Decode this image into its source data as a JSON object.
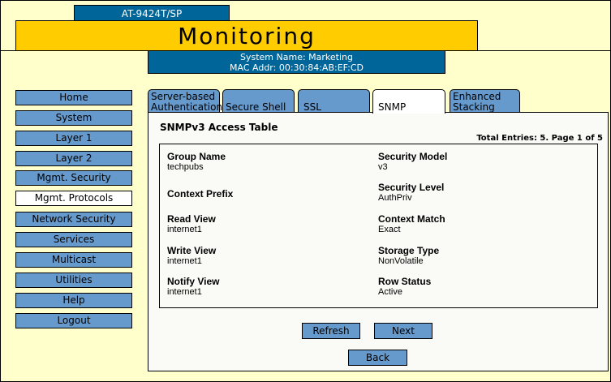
{
  "header": {
    "model": "AT-9424T/SP",
    "title": "Monitoring",
    "system_name": "System Name: Marketing",
    "mac_addr": "MAC Addr: 00:30:84:AB:EF:CD"
  },
  "sidebar": {
    "items": [
      {
        "label": "Home"
      },
      {
        "label": "System"
      },
      {
        "label": "Layer 1"
      },
      {
        "label": "Layer 2"
      },
      {
        "label": "Mgmt. Security"
      },
      {
        "label": "Mgmt. Protocols"
      },
      {
        "label": "Network Security"
      },
      {
        "label": "Services"
      },
      {
        "label": "Multicast"
      },
      {
        "label": "Utilities"
      },
      {
        "label": "Help"
      },
      {
        "label": "Logout"
      }
    ],
    "active": "Mgmt. Protocols"
  },
  "tabs": [
    {
      "label": "Server-based Authentication"
    },
    {
      "label": "Secure Shell"
    },
    {
      "label": "SSL"
    },
    {
      "label": "SNMP"
    },
    {
      "label": "Enhanced Stacking"
    }
  ],
  "panel": {
    "title": "SNMPv3 Access Table",
    "entries": "Total Entries: 5. Page 1 of 5",
    "fields": [
      {
        "label": "Group Name",
        "value": "techpubs"
      },
      {
        "label": "Security Model",
        "value": "v3"
      },
      {
        "label": "Context Prefix",
        "value": ""
      },
      {
        "label": "Security Level",
        "value": "AuthPriv"
      },
      {
        "label": "Read View",
        "value": "internet1"
      },
      {
        "label": "Context Match",
        "value": "Exact"
      },
      {
        "label": "Write View",
        "value": "internet1"
      },
      {
        "label": "Storage Type",
        "value": "NonVolatile"
      },
      {
        "label": "Notify View",
        "value": "internet1"
      },
      {
        "label": "Row Status",
        "value": "Active"
      }
    ]
  },
  "buttons": {
    "refresh": "Refresh",
    "next": "Next",
    "back": "Back"
  }
}
